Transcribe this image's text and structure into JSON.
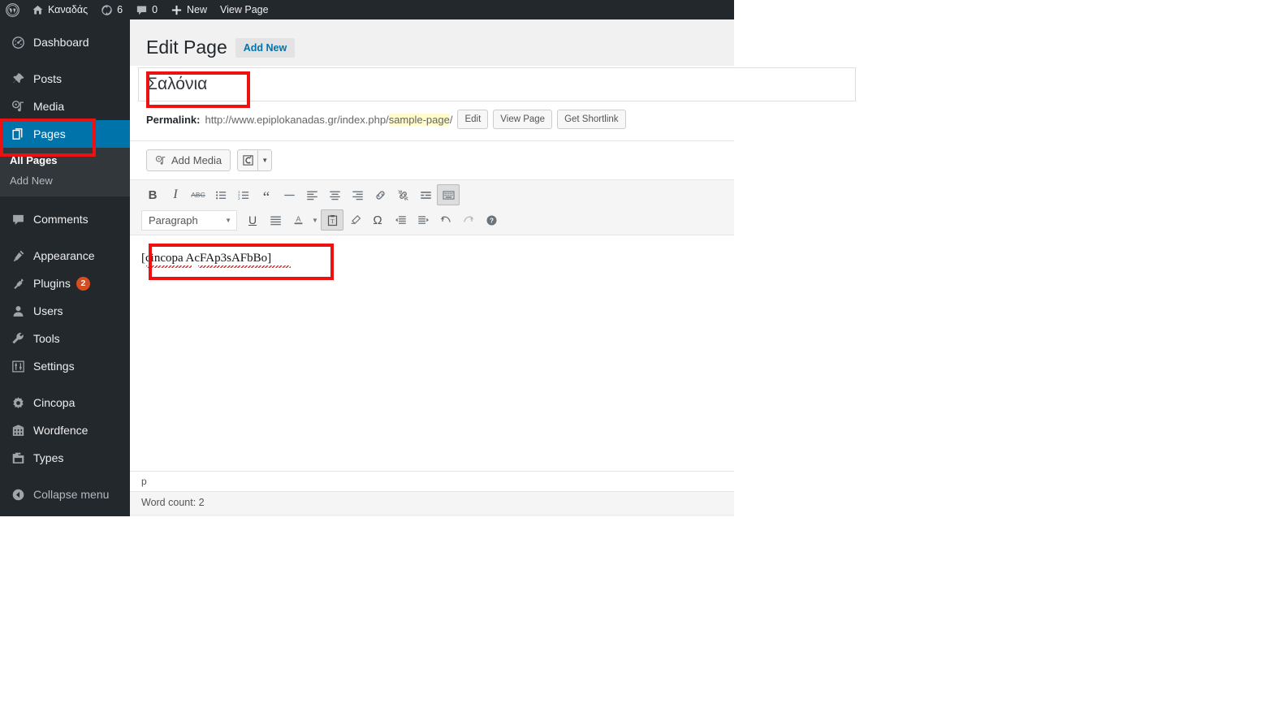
{
  "adminbar": {
    "wp_logo": "wordpress-logo",
    "site_name": "Καναδάς",
    "updates_count": "6",
    "comments_count": "0",
    "new_label": "New",
    "view_page_label": "View Page"
  },
  "sidebar": {
    "items": [
      {
        "label": "Dashboard",
        "icon": "dashboard-icon",
        "active": false
      },
      {
        "label": "Posts",
        "icon": "pin-icon",
        "active": false
      },
      {
        "label": "Media",
        "icon": "media-icon",
        "active": false
      },
      {
        "label": "Pages",
        "icon": "pages-icon",
        "active": true
      },
      {
        "label": "Comments",
        "icon": "comment-icon",
        "active": false
      },
      {
        "label": "Appearance",
        "icon": "brush-icon",
        "active": false
      },
      {
        "label": "Plugins",
        "icon": "plug-icon",
        "active": false,
        "badge": "2"
      },
      {
        "label": "Users",
        "icon": "user-icon",
        "active": false
      },
      {
        "label": "Tools",
        "icon": "wrench-icon",
        "active": false
      },
      {
        "label": "Settings",
        "icon": "sliders-icon",
        "active": false
      },
      {
        "label": "Cincopa",
        "icon": "gear-icon",
        "active": false
      },
      {
        "label": "Wordfence",
        "icon": "building-icon",
        "active": false
      },
      {
        "label": "Types",
        "icon": "folder-icon",
        "active": false
      }
    ],
    "submenu": {
      "all_pages": "All Pages",
      "add_new": "Add New"
    },
    "collapse_label": "Collapse menu",
    "collapse_icon": "chevron-left-circle-icon",
    "active_color": "#0073aa",
    "bg_color": "#23282d"
  },
  "page": {
    "heading": "Edit Page",
    "add_new_button": "Add New",
    "title_value": "Σαλόνια",
    "permalink": {
      "label": "Permalink:",
      "base_url": "http://www.epiplokanadas.gr/index.php/",
      "slug": "sample-page",
      "trailing": "/",
      "edit_button": "Edit",
      "view_page_button": "View Page",
      "get_shortlink_button": "Get Shortlink",
      "slug_highlight_color": "#fffbcc"
    }
  },
  "editor": {
    "add_media_label": "Add Media",
    "add_media_icon": "media-icon",
    "cincopa_icon": "cincopa-icon",
    "cincopa_caret": "chevron-down-icon",
    "toolbar_row1": [
      {
        "name": "bold-icon",
        "glyph": "B"
      },
      {
        "name": "italic-icon",
        "glyph": "I"
      },
      {
        "name": "strikethrough-icon",
        "glyph": "ABC"
      },
      {
        "name": "bulleted-list-icon",
        "glyph": ""
      },
      {
        "name": "numbered-list-icon",
        "glyph": ""
      },
      {
        "name": "blockquote-icon",
        "glyph": "“"
      },
      {
        "name": "horizontal-rule-icon",
        "glyph": "—"
      },
      {
        "name": "align-left-icon",
        "glyph": ""
      },
      {
        "name": "align-center-icon",
        "glyph": ""
      },
      {
        "name": "align-right-icon",
        "glyph": ""
      },
      {
        "name": "insert-link-icon",
        "glyph": ""
      },
      {
        "name": "unlink-icon",
        "glyph": ""
      },
      {
        "name": "read-more-icon",
        "glyph": ""
      },
      {
        "name": "toggle-toolbar-icon",
        "glyph": ""
      }
    ],
    "format_select": {
      "value": "Paragraph",
      "caret": "chevron-down-icon"
    },
    "toolbar_row2": [
      {
        "name": "underline-icon",
        "glyph": "U"
      },
      {
        "name": "justify-icon",
        "glyph": ""
      },
      {
        "name": "text-color-icon",
        "glyph": "A"
      },
      {
        "name": "paste-as-text-icon",
        "glyph": ""
      },
      {
        "name": "clear-formatting-icon",
        "glyph": ""
      },
      {
        "name": "special-character-icon",
        "glyph": "Ω"
      },
      {
        "name": "outdent-icon",
        "glyph": ""
      },
      {
        "name": "indent-icon",
        "glyph": ""
      },
      {
        "name": "undo-icon",
        "glyph": ""
      },
      {
        "name": "redo-icon",
        "glyph": ""
      },
      {
        "name": "help-icon",
        "glyph": "?"
      }
    ],
    "content": "[cincopa AcFAp3sAFbBo]",
    "status_path": "p",
    "word_count": "Word count: 2"
  },
  "annotations": {
    "color": "#ee1111",
    "boxes": [
      "pages-menu-item",
      "page-title-field",
      "editor-shortcode"
    ]
  }
}
